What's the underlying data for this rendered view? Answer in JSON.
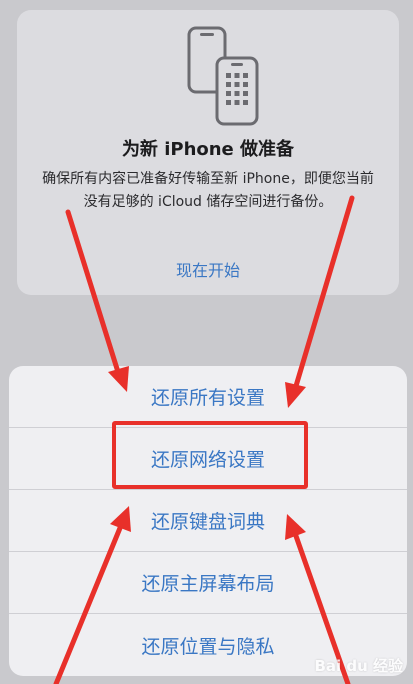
{
  "prepare_card": {
    "icon": "phone-transfer-icon",
    "title": "为新 iPhone 做准备",
    "description": "确保所有内容已准备好传输至新 iPhone，即便您当前没有足够的 iCloud 储存空间进行备份。",
    "action_label": "现在开始"
  },
  "reset_sheet": {
    "items": [
      {
        "label": "还原所有设置"
      },
      {
        "label": "还原网络设置"
      },
      {
        "label": "还原键盘词典"
      },
      {
        "label": "还原主屏幕布局"
      },
      {
        "label": "还原位置与隐私"
      }
    ]
  },
  "annotation": {
    "highlight_color": "#e8302a",
    "highlighted_item": "还原网络设置"
  },
  "watermark": {
    "text": "Bai du 经验"
  },
  "colors": {
    "accent": "#3a77c4",
    "background": "#c9c9cd",
    "card": "#dcdce0",
    "sheet": "#efeff2"
  }
}
